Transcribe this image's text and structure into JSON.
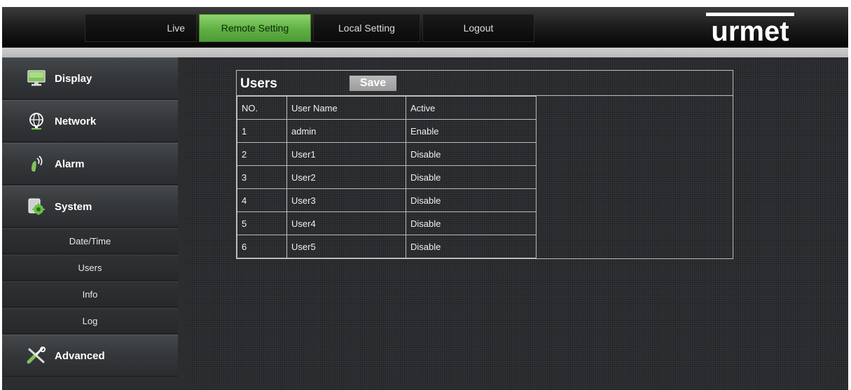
{
  "nav": {
    "tabs": [
      {
        "label": "Live",
        "active": false
      },
      {
        "label": "Remote Setting",
        "active": true
      },
      {
        "label": "Local Setting",
        "active": false
      },
      {
        "label": "Logout",
        "active": false
      }
    ],
    "logo_text": "urmet"
  },
  "sidebar": {
    "menu": [
      {
        "label": "Display",
        "icon": "monitor-icon"
      },
      {
        "label": "Network",
        "icon": "globe-icon"
      },
      {
        "label": "Alarm",
        "icon": "alarm-icon"
      },
      {
        "label": "System",
        "icon": "system-gear-icon"
      },
      {
        "label": "Advanced",
        "icon": "tools-icon"
      }
    ],
    "system_submenu": [
      "Date/Time",
      "Users",
      "Info",
      "Log"
    ]
  },
  "users_panel": {
    "title": "Users",
    "save_label": "Save",
    "headers": [
      "NO.",
      "User Name",
      "Active"
    ],
    "rows": [
      {
        "no": "1",
        "name": "admin",
        "active": "Enable"
      },
      {
        "no": "2",
        "name": "User1",
        "active": "Disable"
      },
      {
        "no": "3",
        "name": "User2",
        "active": "Disable"
      },
      {
        "no": "4",
        "name": "User3",
        "active": "Disable"
      },
      {
        "no": "5",
        "name": "User4",
        "active": "Disable"
      },
      {
        "no": "6",
        "name": "User5",
        "active": "Disable"
      }
    ]
  },
  "colors": {
    "accent_green": "#5fb043",
    "sidebar_bg": "#2b2d2f",
    "content_bg": "#303235"
  }
}
